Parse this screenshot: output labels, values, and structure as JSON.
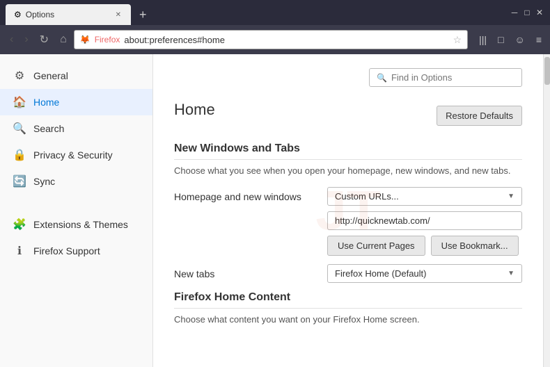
{
  "browser": {
    "tab": {
      "favicon": "⚙",
      "title": "Options",
      "close": "✕"
    },
    "new_tab_btn": "+",
    "window_controls": {
      "minimize": "─",
      "maximize": "□",
      "close": "✕"
    },
    "nav": {
      "back": "‹",
      "forward": "›",
      "refresh": "↻",
      "home": "⌂",
      "favicon": "🦊",
      "brand": "Firefox",
      "address": "about:preferences#home",
      "star": "☆",
      "bookmarks": "|||",
      "tabs": "□",
      "profile": "☺",
      "menu": "≡"
    }
  },
  "find_in_options": {
    "placeholder": "Find in Options",
    "icon": "🔍"
  },
  "page": {
    "title": "Home",
    "restore_button": "Restore Defaults"
  },
  "sidebar": {
    "items": [
      {
        "id": "general",
        "icon": "⚙",
        "label": "General"
      },
      {
        "id": "home",
        "icon": "🏠",
        "label": "Home",
        "active": true
      },
      {
        "id": "search",
        "icon": "🔍",
        "label": "Search"
      },
      {
        "id": "privacy",
        "icon": "🔒",
        "label": "Privacy & Security"
      },
      {
        "id": "sync",
        "icon": "🔄",
        "label": "Sync"
      }
    ],
    "items2": [
      {
        "id": "extensions",
        "icon": "🧩",
        "label": "Extensions & Themes"
      },
      {
        "id": "support",
        "icon": "ℹ",
        "label": "Firefox Support"
      }
    ]
  },
  "main": {
    "sections": [
      {
        "id": "new-windows-tabs",
        "title": "New Windows and Tabs",
        "desc": "Choose what you see when you open your homepage, new windows, and new tabs."
      },
      {
        "id": "firefox-home-content",
        "title": "Firefox Home Content",
        "desc": "Choose what content you want on your Firefox Home screen."
      }
    ],
    "homepage_label": "Homepage and new windows",
    "new_tabs_label": "New tabs",
    "homepage_dropdown": "Custom URLs...",
    "homepage_url": "http://quicknewtab.com/",
    "newtab_dropdown": "Firefox Home (Default)",
    "use_current_pages": "Use Current Pages",
    "use_bookmark": "Use Bookmark..."
  }
}
